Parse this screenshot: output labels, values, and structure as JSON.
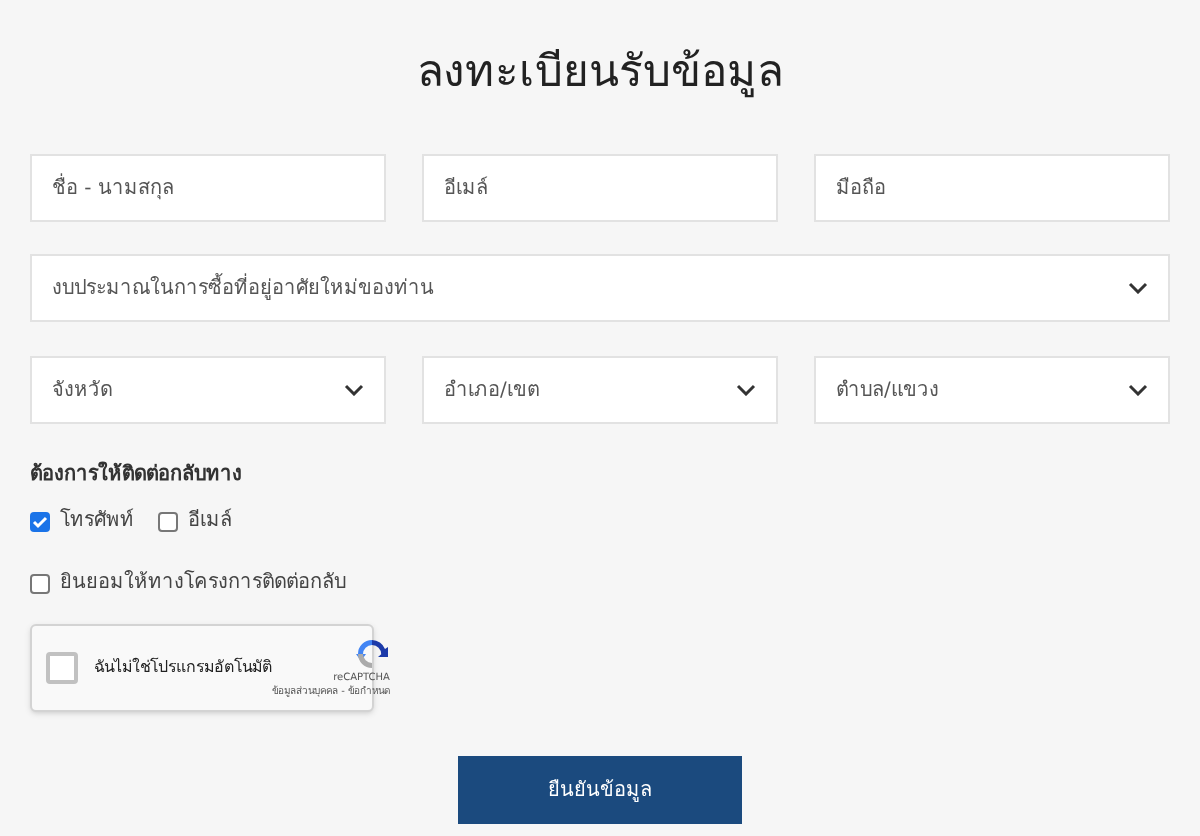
{
  "title": "ลงทะเบียนรับข้อมูล",
  "text_fields": [
    {
      "placeholder": "ชื่อ - นามสกุล"
    },
    {
      "placeholder": "อีเมล์"
    },
    {
      "placeholder": "มือถือ"
    }
  ],
  "budget_select": {
    "placeholder": "งบประมาณในการซื้อที่อยู่อาศัยใหม่ของท่าน"
  },
  "location_selects": [
    {
      "placeholder": "จังหวัด"
    },
    {
      "placeholder": "อำเภอ/เขต"
    },
    {
      "placeholder": "ตำบล/แขวง"
    }
  ],
  "contact_label": "ต้องการให้ติดต่อกลับทาง",
  "contact_options": [
    {
      "label": "โทรศัพท์",
      "checked": true
    },
    {
      "label": "อีเมล์",
      "checked": false
    }
  ],
  "consent": {
    "label": "ยินยอมให้ทางโครงการติดต่อกลับ",
    "checked": false
  },
  "recaptcha": {
    "label": "ฉันไม่ใช่โปรแกรมอัตโนมัติ",
    "checked": false,
    "brand": "reCAPTCHA",
    "links": "ข้อมูลส่วนบุคคล - ข้อกำหนด"
  },
  "submit": "ยืนยันข้อมูล"
}
